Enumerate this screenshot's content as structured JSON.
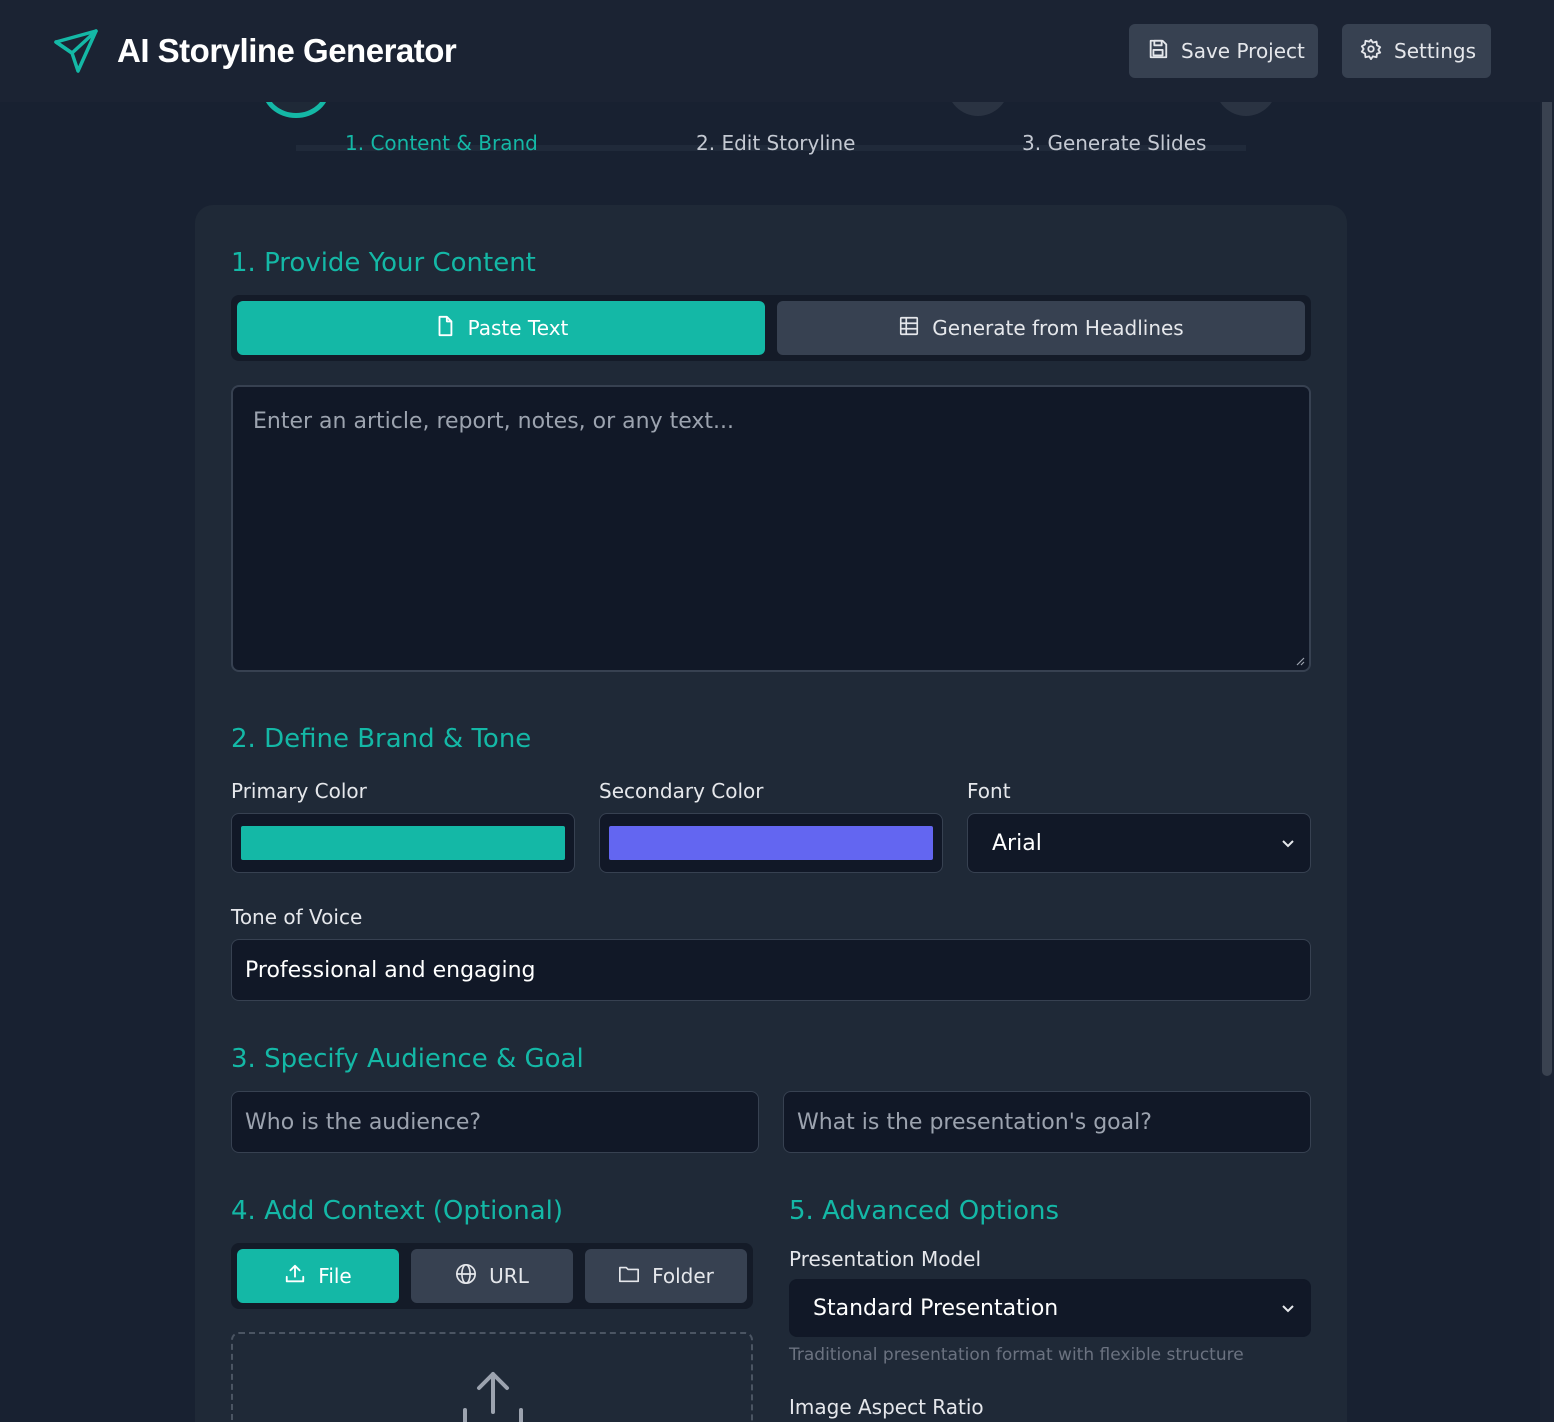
{
  "header": {
    "title": "AI Storyline Generator",
    "save_label": "Save Project",
    "settings_label": "Settings",
    "logo_icon": "paper-plane-icon"
  },
  "steps": [
    {
      "label": "1. Content & Brand",
      "active": true
    },
    {
      "label": "2. Edit Storyline",
      "active": false
    },
    {
      "label": "3. Generate Slides",
      "active": false
    }
  ],
  "content": {
    "title": "1. Provide Your Content",
    "tabs": [
      {
        "label": "Paste Text",
        "icon": "document-icon",
        "active": true
      },
      {
        "label": "Generate from Headlines",
        "icon": "table-icon",
        "active": false
      }
    ],
    "placeholder": "Enter an article, report, notes, or any text..."
  },
  "brand": {
    "title": "2. Define Brand & Tone",
    "primary_label": "Primary Color",
    "primary_color": "#14b8a6",
    "secondary_label": "Secondary Color",
    "secondary_color": "#6366f1",
    "font_label": "Font",
    "font_value": "Arial",
    "tone_label": "Tone of Voice",
    "tone_value": "Professional and engaging"
  },
  "audience": {
    "title": "3. Specify Audience & Goal",
    "audience_placeholder": "Who is the audience?",
    "goal_placeholder": "What is the presentation's goal?"
  },
  "context": {
    "title": "4. Add Context (Optional)",
    "tabs": [
      {
        "label": "File",
        "icon": "upload-icon",
        "active": true
      },
      {
        "label": "URL",
        "icon": "globe-icon",
        "active": false
      },
      {
        "label": "Folder",
        "icon": "folder-icon",
        "active": false
      }
    ]
  },
  "advanced": {
    "title": "5. Advanced Options",
    "model_label": "Presentation Model",
    "model_value": "Standard Presentation",
    "model_hint": "Traditional presentation format with flexible structure",
    "aspect_label": "Image Aspect Ratio"
  },
  "colors": {
    "accent": "#14b8a6",
    "background": "#182131",
    "card": "#1f2937"
  }
}
